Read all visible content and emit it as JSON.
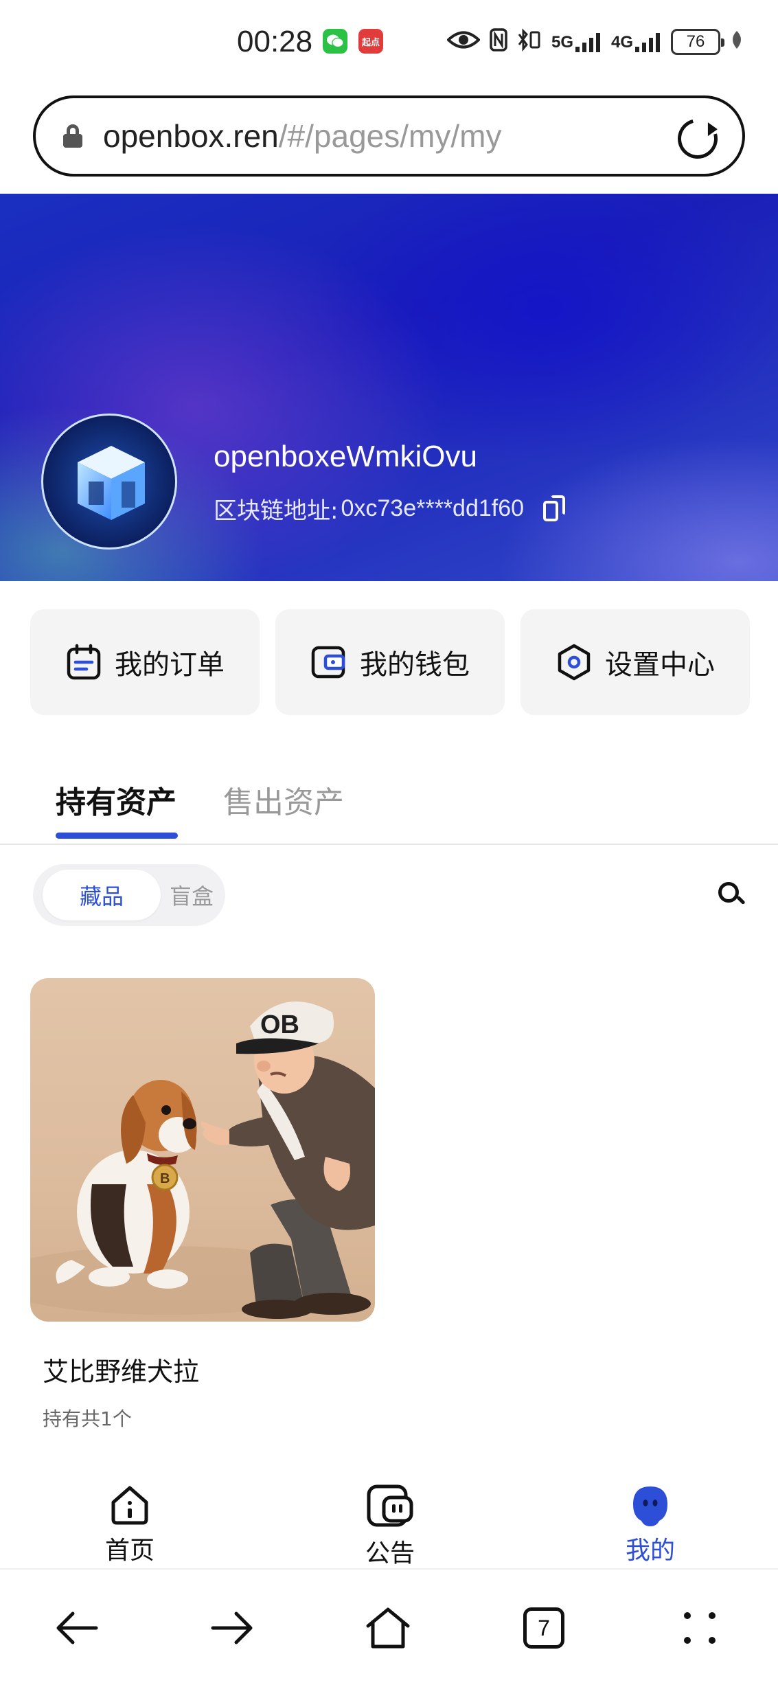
{
  "status_bar": {
    "time": "00:28",
    "wechat_badge": "",
    "qidian_badge": "起点",
    "network_5g": "5G",
    "network_4g": "4G",
    "battery": "76"
  },
  "browser": {
    "url_domain": "openbox.ren",
    "url_path": "/#/pages/my/my",
    "tab_count": "7"
  },
  "profile": {
    "username": "openboxeWmkiOvu",
    "chain_label": "区块链地址:",
    "chain_address": "0xc73e****dd1f60"
  },
  "quick_actions": [
    {
      "label": "我的订单",
      "icon": "calendar-icon"
    },
    {
      "label": "我的钱包",
      "icon": "wallet-icon"
    },
    {
      "label": "设置中心",
      "icon": "hexagon-settings-icon"
    }
  ],
  "tabs": {
    "holding": "持有资产",
    "sold": "售出资产",
    "active": "holding"
  },
  "segment": {
    "collectibles": "藏品",
    "blind_box": "盲盒",
    "active": "collectibles"
  },
  "assets": [
    {
      "title": "艾比野维犬拉",
      "count": "持有共1个"
    }
  ],
  "tabbar": {
    "home": "首页",
    "notice": "公告",
    "mine": "我的",
    "active": "mine"
  },
  "colors": {
    "accent": "#2d4fd8",
    "banner_primary": "#1a1fb8"
  }
}
